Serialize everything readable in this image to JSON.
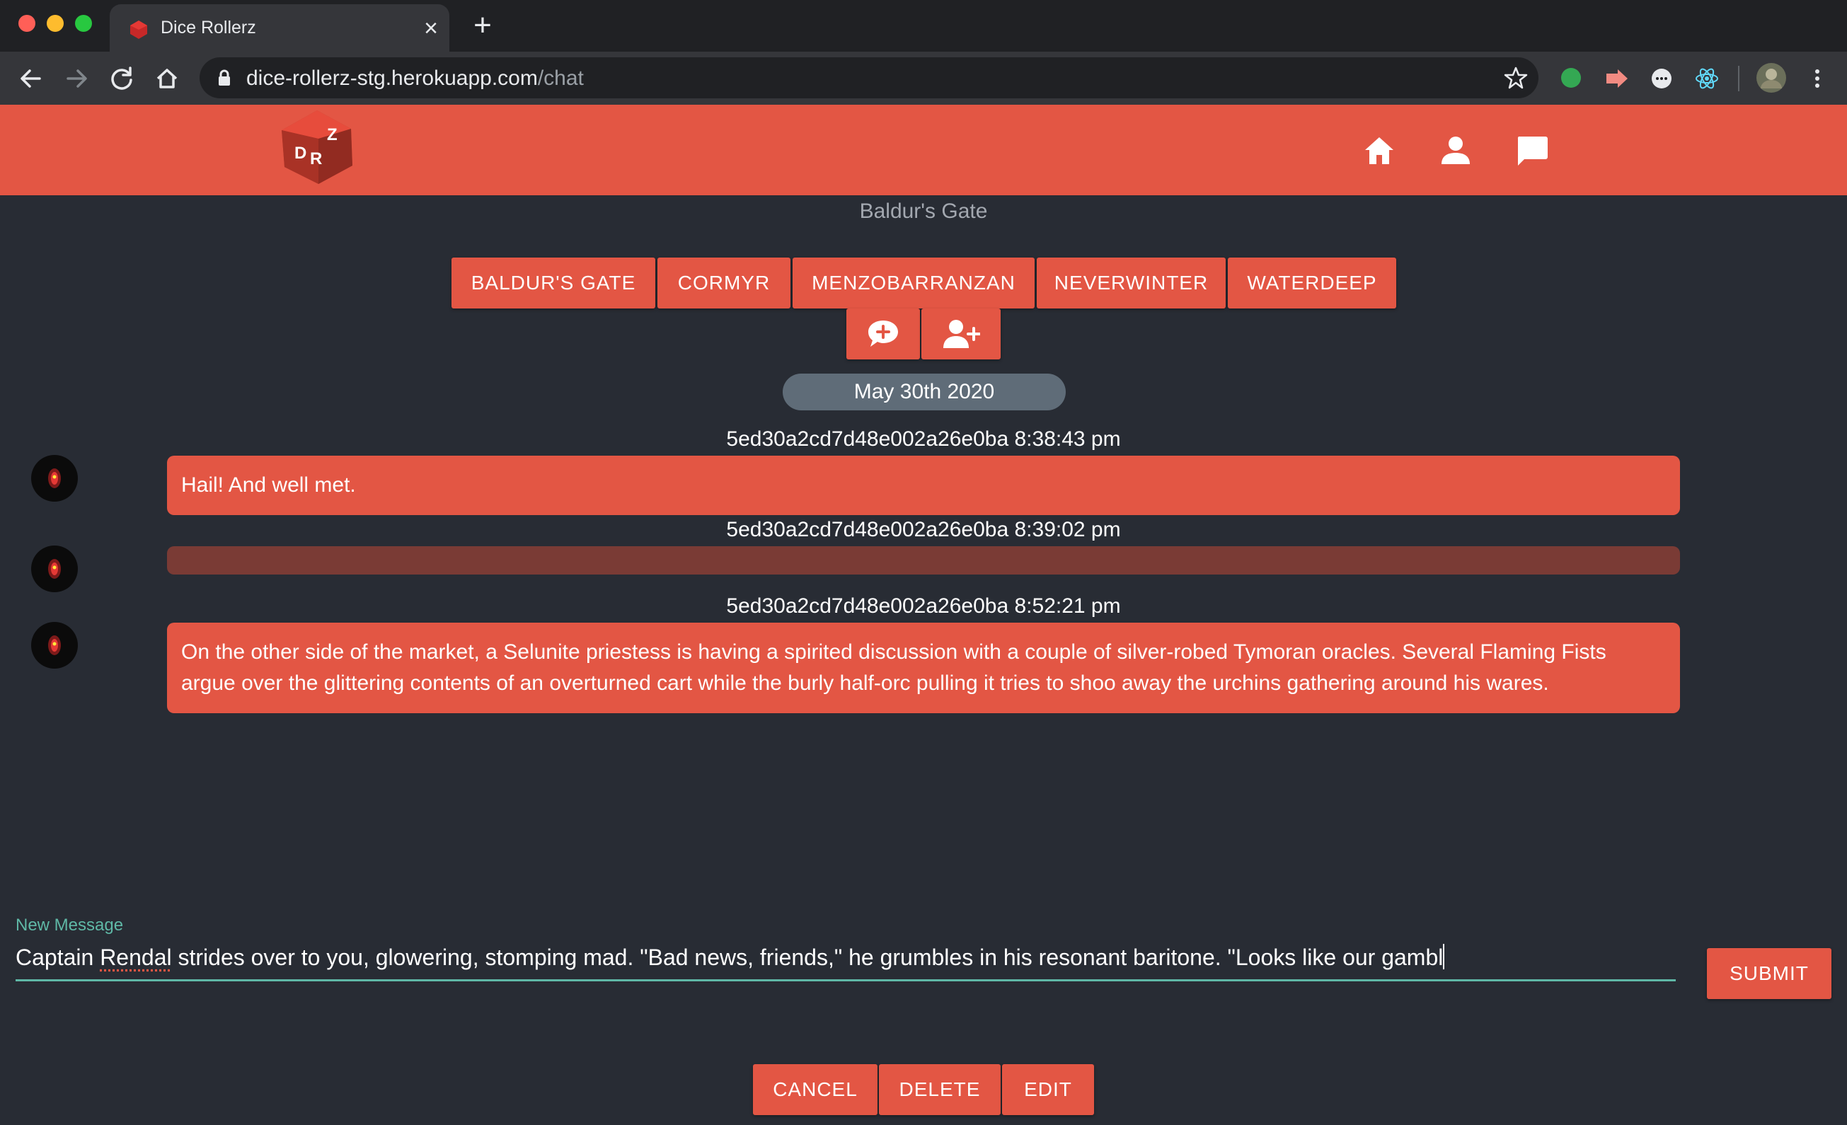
{
  "browser": {
    "tab_title": "Dice Rollerz",
    "tab_close": "×",
    "new_tab": "+",
    "url_host": "dice-rollerz-stg.herokuapp.com",
    "url_path": "/chat"
  },
  "header": {
    "logo_letters": [
      "D",
      "R",
      "Z"
    ],
    "nav_icons": [
      "home-icon",
      "user-icon",
      "chat-icon"
    ]
  },
  "page": {
    "title": "Baldur's Gate"
  },
  "rooms": [
    {
      "label": "BALDUR'S GATE"
    },
    {
      "label": "CORMYR"
    },
    {
      "label": "MENZOBARRANZAN"
    },
    {
      "label": "NEVERWINTER"
    },
    {
      "label": "WATERDEEP"
    }
  ],
  "actions": [
    {
      "icon": "add-comment-icon"
    },
    {
      "icon": "add-user-icon"
    }
  ],
  "chat": {
    "date": "May 30th 2020",
    "messages": [
      {
        "meta": "5ed30a2cd7d48e002a26e0ba 8:38:43 pm",
        "text": "Hail! And well met."
      },
      {
        "meta": "5ed30a2cd7d48e002a26e0ba 8:39:02 pm",
        "text": ""
      },
      {
        "meta": "5ed30a2cd7d48e002a26e0ba 8:52:21 pm",
        "text": "On the other side of the market, a Selunite priestess is having a spirited discussion with a couple of silver-robed Tymoran oracles. Several Flaming Fists argue over the glittering contents of an overturned cart while the burly half-orc pulling it tries to shoo away the urchins gathering around his wares."
      }
    ]
  },
  "composer": {
    "label": "New Message",
    "value_before": "Captain ",
    "value_spell": "Rendal",
    "value_after": " strides over to you, glowering, stomping mad. \"Bad news, friends,\" he grumbles in his resonant baritone. \"Looks like our gambl",
    "submit_label": "SUBMIT"
  },
  "bottom_actions": {
    "cancel": "CANCEL",
    "delete": "DELETE",
    "edit": "EDIT"
  },
  "colors": {
    "accent": "#e35644",
    "background": "#282c34",
    "teal": "#5fb8a6"
  }
}
